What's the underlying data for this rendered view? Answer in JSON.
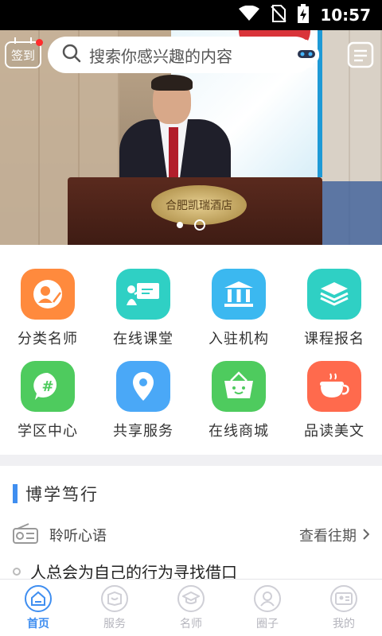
{
  "status_bar": {
    "time": "10:57"
  },
  "header": {
    "checkin_label": "签到",
    "search_placeholder": "搜索你感兴趣的内容"
  },
  "banner": {
    "plaque_text": "合肥凯瑞酒店",
    "slide_count": 2,
    "active_slide": 2
  },
  "grid": {
    "items": [
      {
        "label": "分类名师",
        "icon": "teacher-icon",
        "color": "#ff8a3d"
      },
      {
        "label": "在线课堂",
        "icon": "classroom-icon",
        "color": "#2fd0c4"
      },
      {
        "label": "入驻机构",
        "icon": "institution-icon",
        "color": "#3bb8f0"
      },
      {
        "label": "课程报名",
        "icon": "course-signup-icon",
        "color": "#2fd0c4"
      },
      {
        "label": "学区中心",
        "icon": "school-district-icon",
        "color": "#4ecb5e"
      },
      {
        "label": "共享服务",
        "icon": "location-pin-icon",
        "color": "#4aa8f7"
      },
      {
        "label": "在线商城",
        "icon": "shopping-basket-icon",
        "color": "#4ecb5e"
      },
      {
        "label": "品读美文",
        "icon": "coffee-cup-icon",
        "color": "#ff6a4d"
      }
    ]
  },
  "section": {
    "title": "博学笃行",
    "listen_label": "聆听心语",
    "history_label": "查看往期",
    "quote": "人总会为自己的行为寻找借口"
  },
  "tabbar": {
    "items": [
      {
        "label": "首页",
        "active": true
      },
      {
        "label": "服务",
        "active": false
      },
      {
        "label": "名师",
        "active": false
      },
      {
        "label": "圈子",
        "active": false
      },
      {
        "label": "我的",
        "active": false
      }
    ]
  },
  "colors": {
    "accent": "#3f8ef0",
    "status_bar": "#000000"
  }
}
